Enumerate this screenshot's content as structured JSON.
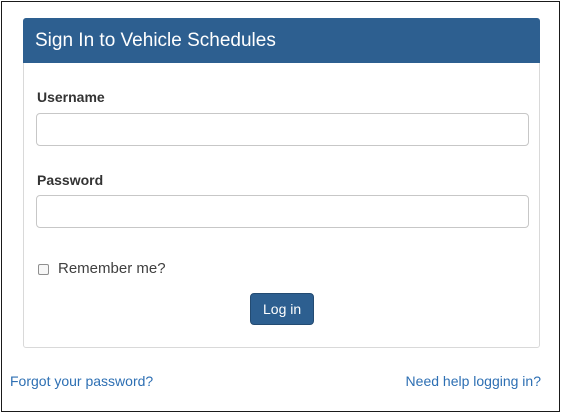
{
  "login_panel": {
    "title": "Sign In to Vehicle Schedules",
    "username_label": "Username",
    "username_value": "",
    "password_label": "Password",
    "password_value": "",
    "remember_label": "Remember me?",
    "remember_checked": false,
    "login_button_label": "Log in"
  },
  "footer_links": {
    "forgot_password": "Forgot your password?",
    "need_help": "Need help logging in?"
  },
  "colors": {
    "brand": "#2d5f90",
    "link": "#2d6fb3"
  }
}
